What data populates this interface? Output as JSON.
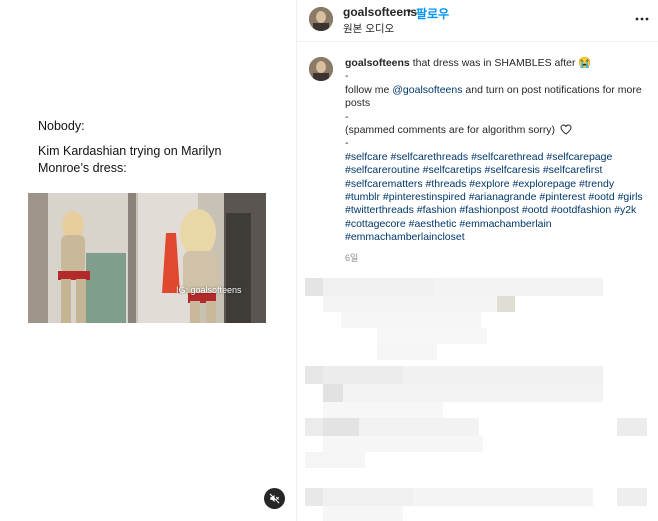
{
  "media": {
    "meme_lines": [
      "Nobody:",
      "Kim Kardashian trying on Marilyn Monroe’s dress:"
    ],
    "watermark": "IG: goalsofteens",
    "mute_icon": "speaker-muted-icon"
  },
  "header": {
    "username": "goalsofteens",
    "separator": "•",
    "follow_label": "팔로우",
    "audio_label": "원본 오디오",
    "more_icon": "more-options-icon"
  },
  "caption": {
    "username": "goalsofteens",
    "text1": "that dress was in SHAMBLES after 😭",
    "dash1": "-",
    "follow_prefix": "follow me ",
    "mention": "@goalsofteens",
    "follow_suffix": " and turn on post notifications for more posts",
    "dash2": "-",
    "spam_note": "(spammed comments are for algorithm sorry)",
    "dash3": "-",
    "hashtags": "#selfcare #selfcarethreads #selfcarethread #selfcarepage #selfcareroutine #selfcaretips #selfcaresis #selfcarefirst #selfcarematters #threads #explore #explorepage #trendy #tumblr #pinterestinspired #arianagrande #pinterest #ootd #girls #twitterthreads #fashion #fashionpost #ootd #ootdfashion #y2k #cottagecore #aesthetic #emmachamberlain #emmachamberlaincloset",
    "time": "6일"
  },
  "colors": {
    "link": "#00376b",
    "follow": "#0095f6",
    "muted_text": "#8e8e8e"
  }
}
